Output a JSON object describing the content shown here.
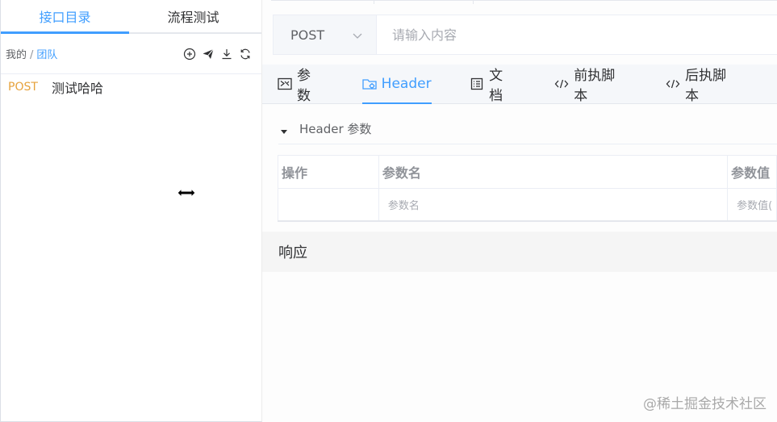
{
  "sidebar": {
    "tabs": [
      {
        "label": "接口目录",
        "active": true
      },
      {
        "label": "流程测试",
        "active": false
      }
    ],
    "breadcrumb": {
      "root": "我的",
      "separator": "/",
      "current": "团队"
    },
    "tools": [
      "add-circle-icon",
      "send-icon",
      "download-icon",
      "refresh-icon"
    ],
    "apis": [
      {
        "method": "POST",
        "name": "测试哈哈"
      }
    ]
  },
  "request": {
    "method": "POST",
    "url_placeholder": "请输入内容",
    "url_value": ""
  },
  "tabs": [
    {
      "label": "参数",
      "icon": "params-icon",
      "active": false
    },
    {
      "label": "Header",
      "icon": "folder-gear-icon",
      "active": true
    },
    {
      "label": "文档",
      "icon": "document-icon",
      "active": false
    },
    {
      "label": "前执脚本",
      "icon": "code-icon",
      "active": false
    },
    {
      "label": "后执脚本",
      "icon": "code-icon",
      "active": false
    }
  ],
  "header_section": {
    "title": "Header 参数",
    "columns": [
      "操作",
      "参数名",
      "参数值"
    ],
    "row": {
      "name_placeholder": "参数名",
      "value_placeholder": "参数值("
    }
  },
  "response": {
    "title": "响应"
  },
  "watermark": "@稀土掘金技术社区",
  "colors": {
    "accent": "#409eff",
    "method_post": "#e6a23c",
    "text": "#303133",
    "muted": "#909399"
  }
}
